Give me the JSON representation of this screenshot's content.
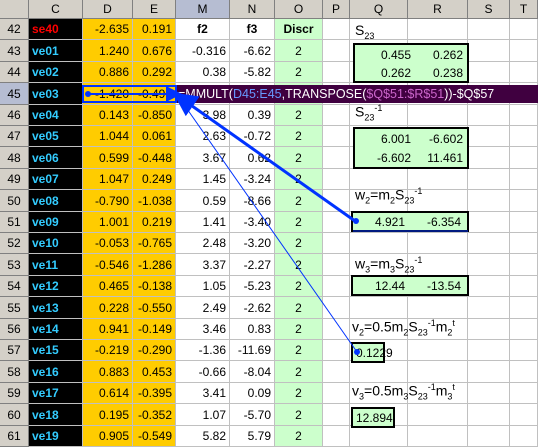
{
  "columns": [
    "C",
    "D",
    "E",
    "M",
    "N",
    "O",
    "P",
    "Q",
    "R",
    "S",
    "T"
  ],
  "selected_column": "M",
  "selected_row": "45",
  "rows": [
    {
      "row": "42",
      "label": "se40",
      "d": "-2.635",
      "e": "0.191",
      "m": "f2",
      "n": "f3",
      "o": "Discr"
    },
    {
      "row": "43",
      "label": "ve01",
      "d": "1.240",
      "e": "0.676",
      "m": "-0.316",
      "n": "-6.62",
      "o": "2"
    },
    {
      "row": "44",
      "label": "ve02",
      "d": "0.886",
      "e": "0.292",
      "m": "0.38",
      "n": "-5.82",
      "o": "2"
    },
    {
      "row": "45",
      "label": "ve03",
      "d": "-1.420",
      "e": "-0.493",
      "m": "",
      "n": "",
      "o": ""
    },
    {
      "row": "46",
      "label": "ve04",
      "d": "0.143",
      "e": "-0.850",
      "m": "3.98",
      "n": "0.39",
      "o": "2"
    },
    {
      "row": "47",
      "label": "ve05",
      "d": "1.044",
      "e": "0.061",
      "m": "2.63",
      "n": "-0.72",
      "o": "2"
    },
    {
      "row": "48",
      "label": "ve06",
      "d": "0.599",
      "e": "-0.448",
      "m": "3.67",
      "n": "0.62",
      "o": "2"
    },
    {
      "row": "49",
      "label": "ve07",
      "d": "1.047",
      "e": "0.249",
      "m": "1.45",
      "n": "-3.24",
      "o": "2"
    },
    {
      "row": "50",
      "label": "ve08",
      "d": "-0.790",
      "e": "-1.038",
      "m": "0.59",
      "n": "-8.66",
      "o": "2"
    },
    {
      "row": "51",
      "label": "ve09",
      "d": "1.001",
      "e": "0.219",
      "m": "1.41",
      "n": "-3.40",
      "o": "2"
    },
    {
      "row": "52",
      "label": "ve10",
      "d": "-0.053",
      "e": "-0.765",
      "m": "2.48",
      "n": "-3.20",
      "o": "2"
    },
    {
      "row": "53",
      "label": "ve11",
      "d": "-0.546",
      "e": "-1.286",
      "m": "3.37",
      "n": "-2.27",
      "o": "2"
    },
    {
      "row": "54",
      "label": "ve12",
      "d": "0.465",
      "e": "-0.138",
      "m": "1.05",
      "n": "-5.23",
      "o": "2"
    },
    {
      "row": "55",
      "label": "ve13",
      "d": "0.228",
      "e": "-0.550",
      "m": "2.49",
      "n": "-2.62",
      "o": "2"
    },
    {
      "row": "56",
      "label": "ve14",
      "d": "0.941",
      "e": "-0.149",
      "m": "3.46",
      "n": "0.83",
      "o": "2"
    },
    {
      "row": "57",
      "label": "ve15",
      "d": "-0.219",
      "e": "-0.290",
      "m": "-1.36",
      "n": "-11.69",
      "o": "2"
    },
    {
      "row": "58",
      "label": "ve16",
      "d": "0.883",
      "e": "0.453",
      "m": "-0.66",
      "n": "-8.04",
      "o": "2"
    },
    {
      "row": "59",
      "label": "ve17",
      "d": "0.614",
      "e": "-0.395",
      "m": "3.41",
      "n": "0.09",
      "o": "2"
    },
    {
      "row": "60",
      "label": "ve18",
      "d": "0.195",
      "e": "-0.352",
      "m": "1.07",
      "n": "-5.70",
      "o": "2"
    },
    {
      "row": "61",
      "label": "ve19",
      "d": "0.905",
      "e": "-0.549",
      "m": "5.82",
      "n": "5.79",
      "o": "2"
    }
  ],
  "formula": {
    "prefix": "=MMULT(",
    "ref1": "D45:E45",
    "mid": ",TRANSPOSE(",
    "ref2": "$Q$51:$R$51",
    "suffix": "))-$Q$57"
  },
  "blocks": {
    "s23_label": {
      "base": "S",
      "sub": "23"
    },
    "s23": [
      [
        "0.455",
        "0.262"
      ],
      [
        "0.262",
        "0.238"
      ]
    ],
    "s23inv_label": {
      "base": "S",
      "sub": "23",
      "sup": "-1"
    },
    "s23inv": [
      [
        "6.001",
        "-6.602"
      ],
      [
        "-6.602",
        "11.461"
      ]
    ],
    "w2_label": {
      "lhs": "w",
      "lhs_sub": "2",
      "eq": "=m",
      "m_sub": "2",
      "s": "S",
      "s_sub": "23",
      "s_sup": "-1"
    },
    "w2": [
      "4.921",
      "-6.354"
    ],
    "w3_label": {
      "lhs": "w",
      "lhs_sub": "3",
      "eq": "=m",
      "m_sub": "3",
      "s": "S",
      "s_sub": "23",
      "s_sup": "-1"
    },
    "w3": [
      "12.44",
      "-13.54"
    ],
    "v2_label": {
      "lhs": "v",
      "lhs_sub": "2",
      "eq": "=0.5m",
      "m_sub": "2",
      "s": "S",
      "s_sub": "23",
      "s_sup": "-1",
      "tail": "m",
      "tail_sub": "2",
      "tail_sup": "t"
    },
    "v2": "0.1229",
    "v3_label": {
      "lhs": "v",
      "lhs_sub": "3",
      "eq": "=0.5m",
      "m_sub": "3",
      "s": "S",
      "s_sub": "23",
      "s_sup": "-1",
      "tail": "m",
      "tail_sub": "3",
      "tail_sup": "t"
    },
    "v3": "12.894"
  },
  "colors": {
    "label_bg": "#000000",
    "label_text": "#33ccff",
    "header_text": "#ff0000",
    "data_bg": "#ffcc00",
    "green_bg": "#ccffcc",
    "formula_bg": "#400040",
    "ref1_color": "#6699ff",
    "ref2_color": "#cc66cc",
    "arrow_blue": "#0033ff"
  }
}
